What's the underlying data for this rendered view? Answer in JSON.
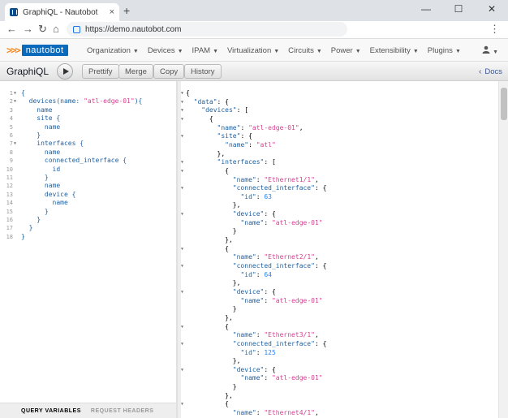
{
  "browser": {
    "tab_title": "GraphiQL - Nautobot",
    "tab_close": "×",
    "new_tab": "+",
    "minimize": "—",
    "maximize": "☐",
    "close": "✕",
    "back": "←",
    "forward": "→",
    "reload": "↻",
    "home": "⌂",
    "url": "https://demo.nautobot.com",
    "menu": "⋮"
  },
  "navbar": {
    "logo_text": "nautobot",
    "logo_prefix": ">>>",
    "items": [
      "Organization",
      "Devices",
      "IPAM",
      "Virtualization",
      "Circuits",
      "Power",
      "Extensibility",
      "Plugins"
    ],
    "user_icon": "person-icon"
  },
  "toolbar": {
    "title": "GraphiQL",
    "prettify": "Prettify",
    "merge": "Merge",
    "copy": "Copy",
    "history": "History",
    "docs": "Docs"
  },
  "query": {
    "lines": [
      "{",
      "  devices(name: \"atl-edge-01\"){",
      "    name",
      "    site {",
      "      name",
      "    }",
      "    interfaces {",
      "      name",
      "      connected_interface {",
      "        id",
      "      }",
      "",
      "      name",
      "      device {",
      "        name",
      "      }",
      "    }",
      "  }",
      "}"
    ],
    "line_numbers": [
      "1",
      "2",
      "3",
      "4",
      "5",
      "6",
      "7",
      "8",
      "9",
      "10",
      "11",
      "12",
      "13",
      "14",
      "15",
      "16",
      "17",
      "18"
    ]
  },
  "bottom_tabs": {
    "query_variables": "QUERY VARIABLES",
    "request_headers": "REQUEST HEADERS"
  },
  "result": {
    "lines": [
      "{",
      "  \"data\": {",
      "    \"devices\": [",
      "      {",
      "        \"name\": \"atl-edge-01\",",
      "        \"site\": {",
      "          \"name\": \"atl\"",
      "        },",
      "        \"interfaces\": [",
      "          {",
      "            \"name\": \"Ethernet1/1\",",
      "            \"connected_interface\": {",
      "              \"id\": 63",
      "            },",
      "            \"device\": {",
      "              \"name\": \"atl-edge-01\"",
      "            }",
      "          },",
      "          {",
      "            \"name\": \"Ethernet2/1\",",
      "            \"connected_interface\": {",
      "              \"id\": 64",
      "            },",
      "            \"device\": {",
      "              \"name\": \"atl-edge-01\"",
      "            }",
      "          },",
      "          {",
      "            \"name\": \"Ethernet3/1\",",
      "            \"connected_interface\": {",
      "              \"id\": 125",
      "            },",
      "            \"device\": {",
      "              \"name\": \"atl-edge-01\"",
      "            }",
      "          },",
      "          {",
      "            \"name\": \"Ethernet4/1\","
    ]
  }
}
